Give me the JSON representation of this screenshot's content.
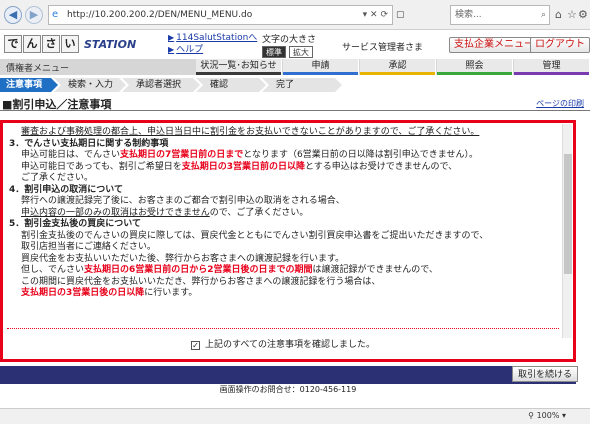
{
  "browser": {
    "url": "http://10.200.200.2/DEN/MENU_MENU.do",
    "search_placeholder": "検索..."
  },
  "header": {
    "logo_chars": [
      "で",
      "ん",
      "さ",
      "い"
    ],
    "logo_station": "STATION",
    "link_top": "114SalutStationへ",
    "link_help": "ヘルプ",
    "font_size_label": "文字の大きさ",
    "font_standard": "標準",
    "font_large": "拡大",
    "user": "サービス管理者さま",
    "support_button": "支払企業メニュー",
    "logout_button": "ログアウト"
  },
  "menu": {
    "title": "債権者メニュー",
    "tabs": [
      {
        "label": "状況一覧･お知らせ",
        "color": "#3a3a3a"
      },
      {
        "label": "申請",
        "color": "#2e6fd0"
      },
      {
        "label": "承認",
        "color": "#e8b400"
      },
      {
        "label": "照会",
        "color": "#3aa83a"
      },
      {
        "label": "管理",
        "color": "#7a3ab0"
      }
    ]
  },
  "steps": [
    "注意事項",
    "検索・入力",
    "承認者選択",
    "確認",
    "完了"
  ],
  "page": {
    "title": "■割引申込／注意事項",
    "print_link": "ページの印刷"
  },
  "terms": {
    "l1": "審査および事務処理の都合上、申込日当日中に割引金をお支払いできないことがありますので、ご了承ください。",
    "s3": "3．でんさい支払期日に関する制約事項",
    "s3_a1": "申込可能日は、でんさい",
    "s3_a2": "支払期日の7営業日前の日まで",
    "s3_a3": "となります（6営業日前の日以降は割引申込できません）。",
    "s3_b1": "申込可能日であっても、割引ご希望日を",
    "s3_b2": "支払期日の3営業日前の日以降",
    "s3_b3": "とする申込はお受けできませんので、",
    "s3_c": "ご了承ください。",
    "s4": "4．割引申込の取消について",
    "s4_a": "弊行への譲渡記録完了後に、お客さまのご都合で割引申込の取消をされる場合、",
    "s4_b1": "申込内容の一部のみの取消はお受けできません",
    "s4_b2": "ので、ご了承ください。",
    "s5": "5．割引金支払後の買戻について",
    "s5_a": "割引金支払後のでんさいの買戻に際しては、買戻代金とともにでんさい割引買戻申込書をご提出いただきますので、",
    "s5_b": "取引店担当者にご連絡ください。",
    "s5_c": "買戻代金をお支払いいただいた後、弊行からお客さまへの譲渡記録を行います。",
    "s5_d1": "但し、でんさい",
    "s5_d2": "支払期日の6営業日前の日から2営業日後の日までの期間",
    "s5_d3": "は譲渡記録ができませんので、",
    "s5_e": "この期間に買戻代金をお支払いいただき、弊行からお客さまへの譲渡記録を行う場合は、",
    "s5_f1": "支払期日の3営業日後の日以降",
    "s5_f2": "に行います。",
    "confirm": "上記のすべての注意事項を確認しました。"
  },
  "footer": {
    "next_button": "取引を続ける",
    "contact": "画面操作のお問合せ：0120-456-119",
    "zoom": "100%"
  }
}
